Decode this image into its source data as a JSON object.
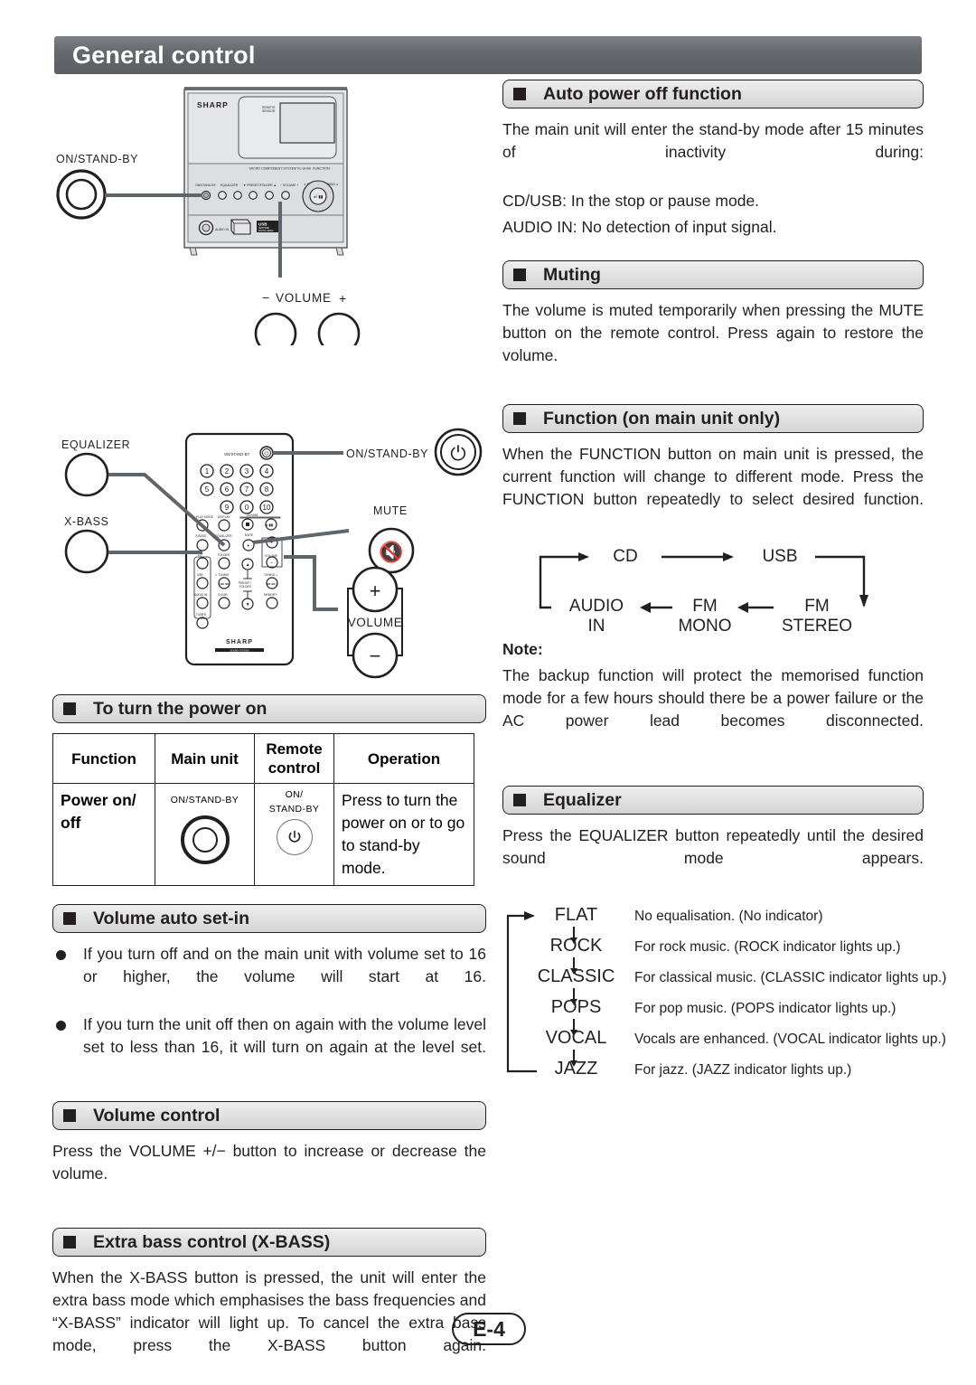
{
  "page": {
    "title": "General control",
    "page_number": "E-4"
  },
  "main_unit_diagram": {
    "brand": "SHARP",
    "remote_sensor_label": "REMOTE SENSOR",
    "model_label": "MICRO COMPONENT SYSTEM XL-UH06",
    "function_label": "FUNCTION",
    "panel_buttons": [
      "ON/STAND-BY",
      "EQUALIZER",
      "PRESET/FOLDER",
      "VOLUME"
    ],
    "tuning_down_label": "TUNING",
    "tuning_up_label": "TUNING",
    "audio_in_label": "AUDIO IN",
    "usb_label": "USB",
    "callouts": {
      "standby": "ON/STAND-BY",
      "volume_minus": "−",
      "volume": "VOLUME",
      "volume_plus": "+"
    }
  },
  "remote_diagram": {
    "brand": "SHARP",
    "sub_brand": "SOUND SYSTEM",
    "standby_label": "ON/STAND-BY",
    "number_keys": [
      "1",
      "2",
      "3",
      "4",
      "5",
      "6",
      "7",
      "8",
      "9",
      "0",
      "10"
    ],
    "key_labels": [
      "PLAY MODE",
      "DISPLAY",
      "CD/USB",
      "X-BASS",
      "EQUALIZER",
      "MUTE",
      "VOLUME",
      "CD",
      "FOLDER",
      "TUNING",
      "USB",
      "PRESET/FOLDER",
      "AUDIO IN",
      "CLEAR",
      "MEMORY",
      "TUNER"
    ],
    "callouts": {
      "equalizer": "EQUALIZER",
      "xbass": "X-BASS",
      "standby": "ON/STAND-BY",
      "mute": "MUTE",
      "volume": "VOLUME",
      "volume_plus": "+",
      "volume_minus": "−"
    }
  },
  "left_column": {
    "power_on": {
      "heading": "To turn the power on",
      "table": {
        "headers": [
          "Function",
          "Main unit",
          "Remote control",
          "Operation"
        ],
        "rows": [
          {
            "function": "Power on/ off",
            "main_unit_label": "ON/STAND-BY",
            "remote_label_line1": "ON/",
            "remote_label_line2": "STAND-BY",
            "operation": "Press to turn the power on or to go to stand-by mode."
          }
        ]
      }
    },
    "volume_auto": {
      "heading": "Volume auto set-in",
      "bullets": [
        "If you turn off and on the main unit with volume set to 16 or higher, the volume will start at 16.",
        "If you turn the unit off then on again with the volume level set to less than 16, it will turn on again at the level set."
      ]
    },
    "volume_control": {
      "heading": "Volume control",
      "body": "Press the VOLUME +/− button to increase or decrease the volume."
    },
    "xbass": {
      "heading": "Extra bass control (X-BASS)",
      "body": "When the X-BASS button is pressed, the unit will enter the extra bass mode which emphasises the bass frequencies and “X-BASS” indicator will light up. To cancel the extra bass mode, press the X-BASS button again."
    }
  },
  "right_column": {
    "auto_power_off": {
      "heading": "Auto power off function",
      "body": "The main unit will enter the stand-by mode after 15 minutes of inactivity during:",
      "lines": [
        "CD/USB: In the stop or pause mode.",
        "AUDIO IN: No detection of input signal."
      ]
    },
    "muting": {
      "heading": "Muting",
      "body": "The volume is muted temporarily when pressing the MUTE button on the remote control. Press again to restore the volume."
    },
    "function": {
      "heading": "Function (on main unit only)",
      "body": "When the FUNCTION button on main unit is pressed, the current function will change to different mode. Press the FUNCTION button repeatedly to select desired function.",
      "flow": {
        "top": [
          "CD",
          "USB"
        ],
        "bottom": [
          "AUDIO IN",
          "FM MONO",
          "FM STEREO"
        ],
        "audio_in_l1": "AUDIO",
        "audio_in_l2": "IN",
        "fm_mono_l1": "FM",
        "fm_mono_l2": "MONO",
        "fm_stereo_l1": "FM",
        "fm_stereo_l2": "STEREO"
      },
      "note_label": "Note:",
      "note_body": "The backup function will protect the memorised function mode for a few hours should there be a power failure or the AC power lead becomes disconnected."
    },
    "equalizer": {
      "heading": "Equalizer",
      "body": "Press the EQUALIZER button repeatedly until the desired sound mode appears.",
      "modes": [
        {
          "name": "FLAT",
          "desc": "No equalisation. (No indicator)"
        },
        {
          "name": "ROCK",
          "desc": "For rock music. (ROCK indicator lights up.)"
        },
        {
          "name": "CLASSIC",
          "desc": "For classical music. (CLASSIC indicator lights up.)"
        },
        {
          "name": "POPS",
          "desc": "For pop music. (POPS indicator lights up.)"
        },
        {
          "name": "VOCAL",
          "desc": "Vocals are enhanced. (VOCAL indicator lights up.)"
        },
        {
          "name": "JAZZ",
          "desc": "For jazz. (JAZZ indicator lights up.)"
        }
      ]
    }
  }
}
